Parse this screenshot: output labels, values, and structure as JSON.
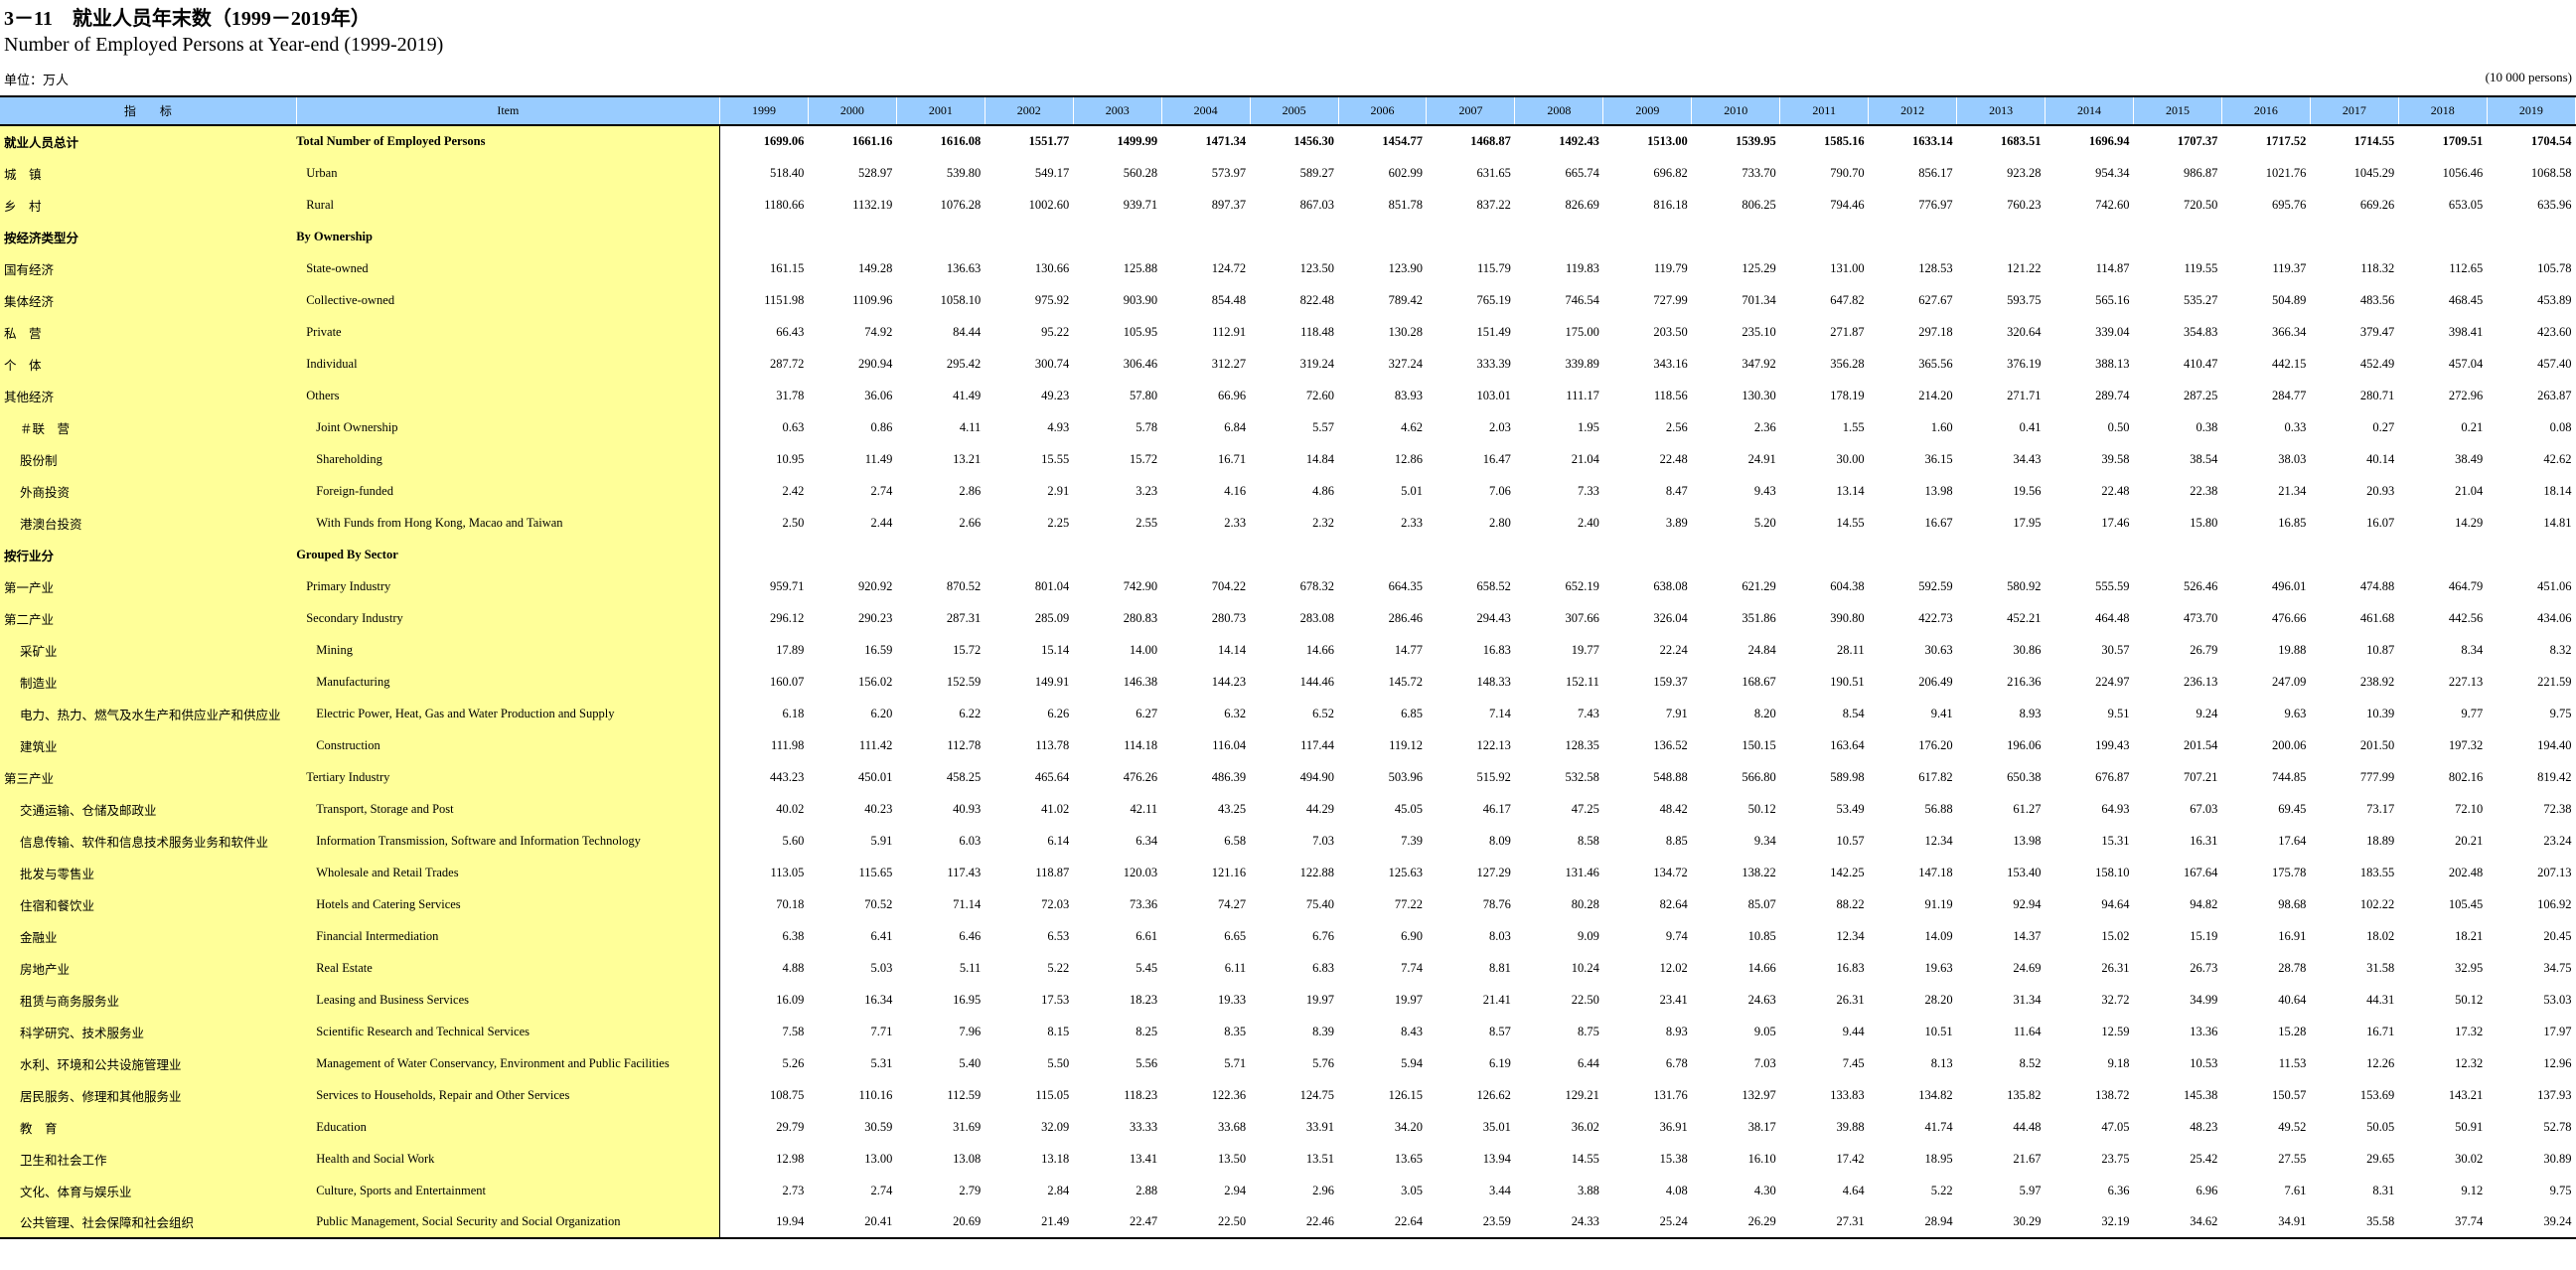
{
  "title_cn": "3－11　就业人员年末数（1999－2019年）",
  "title_en": "Number of Employed Persons at Year-end (1999-2019)",
  "unit_cn": "单位：万人",
  "unit_en": "(10 000 persons)",
  "header": {
    "indicator": "指　　标",
    "item": "Item",
    "years": [
      "1999",
      "2000",
      "2001",
      "2002",
      "2003",
      "2004",
      "2005",
      "2006",
      "2007",
      "2008",
      "2009",
      "2010",
      "2011",
      "2012",
      "2013",
      "2014",
      "2015",
      "2016",
      "2017",
      "2018",
      "2019"
    ]
  },
  "rows": [
    {
      "cn": "就业人员总计",
      "en": "Total Number of Employed Persons",
      "bold": true,
      "ind": 0,
      "v": [
        "1699.06",
        "1661.16",
        "1616.08",
        "1551.77",
        "1499.99",
        "1471.34",
        "1456.30",
        "1454.77",
        "1468.87",
        "1492.43",
        "1513.00",
        "1539.95",
        "1585.16",
        "1633.14",
        "1683.51",
        "1696.94",
        "1707.37",
        "1717.52",
        "1714.55",
        "1709.51",
        "1704.54"
      ]
    },
    {
      "cn": "城　镇",
      "en": "Urban",
      "bold": false,
      "ind": 1,
      "v": [
        "518.40",
        "528.97",
        "539.80",
        "549.17",
        "560.28",
        "573.97",
        "589.27",
        "602.99",
        "631.65",
        "665.74",
        "696.82",
        "733.70",
        "790.70",
        "856.17",
        "923.28",
        "954.34",
        "986.87",
        "1021.76",
        "1045.29",
        "1056.46",
        "1068.58"
      ]
    },
    {
      "cn": "乡　村",
      "en": "Rural",
      "bold": false,
      "ind": 1,
      "v": [
        "1180.66",
        "1132.19",
        "1076.28",
        "1002.60",
        "939.71",
        "897.37",
        "867.03",
        "851.78",
        "837.22",
        "826.69",
        "816.18",
        "806.25",
        "794.46",
        "776.97",
        "760.23",
        "742.60",
        "720.50",
        "695.76",
        "669.26",
        "653.05",
        "635.96"
      ]
    },
    {
      "cn": "按经济类型分",
      "en": "By Ownership",
      "bold": true,
      "ind": 0,
      "v": [
        "",
        "",
        "",
        "",
        "",
        "",
        "",
        "",
        "",
        "",
        "",
        "",
        "",
        "",
        "",
        "",
        "",
        "",
        "",
        "",
        ""
      ]
    },
    {
      "cn": "国有经济",
      "en": "State-owned",
      "bold": false,
      "ind": 1,
      "v": [
        "161.15",
        "149.28",
        "136.63",
        "130.66",
        "125.88",
        "124.72",
        "123.50",
        "123.90",
        "115.79",
        "119.83",
        "119.79",
        "125.29",
        "131.00",
        "128.53",
        "121.22",
        "114.87",
        "119.55",
        "119.37",
        "118.32",
        "112.65",
        "105.78"
      ]
    },
    {
      "cn": "集体经济",
      "en": "Collective-owned",
      "bold": false,
      "ind": 1,
      "v": [
        "1151.98",
        "1109.96",
        "1058.10",
        "975.92",
        "903.90",
        "854.48",
        "822.48",
        "789.42",
        "765.19",
        "746.54",
        "727.99",
        "701.34",
        "647.82",
        "627.67",
        "593.75",
        "565.16",
        "535.27",
        "504.89",
        "483.56",
        "468.45",
        "453.89"
      ]
    },
    {
      "cn": "私　营",
      "en": "Private",
      "bold": false,
      "ind": 1,
      "v": [
        "66.43",
        "74.92",
        "84.44",
        "95.22",
        "105.95",
        "112.91",
        "118.48",
        "130.28",
        "151.49",
        "175.00",
        "203.50",
        "235.10",
        "271.87",
        "297.18",
        "320.64",
        "339.04",
        "354.83",
        "366.34",
        "379.47",
        "398.41",
        "423.60"
      ]
    },
    {
      "cn": "个　体",
      "en": "Individual",
      "bold": false,
      "ind": 1,
      "v": [
        "287.72",
        "290.94",
        "295.42",
        "300.74",
        "306.46",
        "312.27",
        "319.24",
        "327.24",
        "333.39",
        "339.89",
        "343.16",
        "347.92",
        "356.28",
        "365.56",
        "376.19",
        "388.13",
        "410.47",
        "442.15",
        "452.49",
        "457.04",
        "457.40"
      ]
    },
    {
      "cn": "其他经济",
      "en": "Others",
      "bold": false,
      "ind": 1,
      "v": [
        "31.78",
        "36.06",
        "41.49",
        "49.23",
        "57.80",
        "66.96",
        "72.60",
        "83.93",
        "103.01",
        "111.17",
        "118.56",
        "130.30",
        "178.19",
        "214.20",
        "271.71",
        "289.74",
        "287.25",
        "284.77",
        "280.71",
        "272.96",
        "263.87"
      ]
    },
    {
      "cn": "＃联　营",
      "en": "Joint Ownership",
      "bold": false,
      "ind": 2,
      "v": [
        "0.63",
        "0.86",
        "4.11",
        "4.93",
        "5.78",
        "6.84",
        "5.57",
        "4.62",
        "2.03",
        "1.95",
        "2.56",
        "2.36",
        "1.55",
        "1.60",
        "0.41",
        "0.50",
        "0.38",
        "0.33",
        "0.27",
        "0.21",
        "0.08"
      ]
    },
    {
      "cn": "股份制",
      "en": "Shareholding",
      "bold": false,
      "ind": 2,
      "v": [
        "10.95",
        "11.49",
        "13.21",
        "15.55",
        "15.72",
        "16.71",
        "14.84",
        "12.86",
        "16.47",
        "21.04",
        "22.48",
        "24.91",
        "30.00",
        "36.15",
        "34.43",
        "39.58",
        "38.54",
        "38.03",
        "40.14",
        "38.49",
        "42.62"
      ]
    },
    {
      "cn": "外商投资",
      "en": "Foreign-funded",
      "bold": false,
      "ind": 2,
      "v": [
        "2.42",
        "2.74",
        "2.86",
        "2.91",
        "3.23",
        "4.16",
        "4.86",
        "5.01",
        "7.06",
        "7.33",
        "8.47",
        "9.43",
        "13.14",
        "13.98",
        "19.56",
        "22.48",
        "22.38",
        "21.34",
        "20.93",
        "21.04",
        "18.14"
      ]
    },
    {
      "cn": "港澳台投资",
      "en": "With Funds from Hong Kong, Macao and Taiwan",
      "bold": false,
      "ind": 2,
      "v": [
        "2.50",
        "2.44",
        "2.66",
        "2.25",
        "2.55",
        "2.33",
        "2.32",
        "2.33",
        "2.80",
        "2.40",
        "3.89",
        "5.20",
        "14.55",
        "16.67",
        "17.95",
        "17.46",
        "15.80",
        "16.85",
        "16.07",
        "14.29",
        "14.81"
      ]
    },
    {
      "cn": "按行业分",
      "en": "Grouped By Sector",
      "bold": true,
      "ind": 0,
      "v": [
        "",
        "",
        "",
        "",
        "",
        "",
        "",
        "",
        "",
        "",
        "",
        "",
        "",
        "",
        "",
        "",
        "",
        "",
        "",
        "",
        ""
      ]
    },
    {
      "cn": "第一产业",
      "en": "Primary Industry",
      "bold": false,
      "ind": 1,
      "v": [
        "959.71",
        "920.92",
        "870.52",
        "801.04",
        "742.90",
        "704.22",
        "678.32",
        "664.35",
        "658.52",
        "652.19",
        "638.08",
        "621.29",
        "604.38",
        "592.59",
        "580.92",
        "555.59",
        "526.46",
        "496.01",
        "474.88",
        "464.79",
        "451.06"
      ]
    },
    {
      "cn": "第二产业",
      "en": "Secondary Industry",
      "bold": false,
      "ind": 1,
      "v": [
        "296.12",
        "290.23",
        "287.31",
        "285.09",
        "280.83",
        "280.73",
        "283.08",
        "286.46",
        "294.43",
        "307.66",
        "326.04",
        "351.86",
        "390.80",
        "422.73",
        "452.21",
        "464.48",
        "473.70",
        "476.66",
        "461.68",
        "442.56",
        "434.06"
      ]
    },
    {
      "cn": "采矿业",
      "en": "Mining",
      "bold": false,
      "ind": 2,
      "v": [
        "17.89",
        "16.59",
        "15.72",
        "15.14",
        "14.00",
        "14.14",
        "14.66",
        "14.77",
        "16.83",
        "19.77",
        "22.24",
        "24.84",
        "28.11",
        "30.63",
        "30.86",
        "30.57",
        "26.79",
        "19.88",
        "10.87",
        "8.34",
        "8.32"
      ]
    },
    {
      "cn": "制造业",
      "en": "Manufacturing",
      "bold": false,
      "ind": 2,
      "v": [
        "160.07",
        "156.02",
        "152.59",
        "149.91",
        "146.38",
        "144.23",
        "144.46",
        "145.72",
        "148.33",
        "152.11",
        "159.37",
        "168.67",
        "190.51",
        "206.49",
        "216.36",
        "224.97",
        "236.13",
        "247.09",
        "238.92",
        "227.13",
        "221.59"
      ]
    },
    {
      "cn": "电力、热力、燃气及水生产和供应业产和供应业",
      "en": "Electric Power, Heat, Gas and Water Production and Supply",
      "bold": false,
      "ind": 2,
      "v": [
        "6.18",
        "6.20",
        "6.22",
        "6.26",
        "6.27",
        "6.32",
        "6.52",
        "6.85",
        "7.14",
        "7.43",
        "7.91",
        "8.20",
        "8.54",
        "9.41",
        "8.93",
        "9.51",
        "9.24",
        "9.63",
        "10.39",
        "9.77",
        "9.75"
      ]
    },
    {
      "cn": "建筑业",
      "en": "Construction",
      "bold": false,
      "ind": 2,
      "v": [
        "111.98",
        "111.42",
        "112.78",
        "113.78",
        "114.18",
        "116.04",
        "117.44",
        "119.12",
        "122.13",
        "128.35",
        "136.52",
        "150.15",
        "163.64",
        "176.20",
        "196.06",
        "199.43",
        "201.54",
        "200.06",
        "201.50",
        "197.32",
        "194.40"
      ]
    },
    {
      "cn": "第三产业",
      "en": "Tertiary Industry",
      "bold": false,
      "ind": 1,
      "v": [
        "443.23",
        "450.01",
        "458.25",
        "465.64",
        "476.26",
        "486.39",
        "494.90",
        "503.96",
        "515.92",
        "532.58",
        "548.88",
        "566.80",
        "589.98",
        "617.82",
        "650.38",
        "676.87",
        "707.21",
        "744.85",
        "777.99",
        "802.16",
        "819.42"
      ]
    },
    {
      "cn": "交通运输、仓储及邮政业",
      "en": "Transport, Storage and Post",
      "bold": false,
      "ind": 2,
      "v": [
        "40.02",
        "40.23",
        "40.93",
        "41.02",
        "42.11",
        "43.25",
        "44.29",
        "45.05",
        "46.17",
        "47.25",
        "48.42",
        "50.12",
        "53.49",
        "56.88",
        "61.27",
        "64.93",
        "67.03",
        "69.45",
        "73.17",
        "72.10",
        "72.38"
      ]
    },
    {
      "cn": "信息传输、软件和信息技术服务业务和软件业",
      "en": "Information Transmission, Software and Information Technology",
      "bold": false,
      "ind": 2,
      "v": [
        "5.60",
        "5.91",
        "6.03",
        "6.14",
        "6.34",
        "6.58",
        "7.03",
        "7.39",
        "8.09",
        "8.58",
        "8.85",
        "9.34",
        "10.57",
        "12.34",
        "13.98",
        "15.31",
        "16.31",
        "17.64",
        "18.89",
        "20.21",
        "23.24"
      ]
    },
    {
      "cn": "批发与零售业",
      "en": "Wholesale and Retail Trades",
      "bold": false,
      "ind": 2,
      "v": [
        "113.05",
        "115.65",
        "117.43",
        "118.87",
        "120.03",
        "121.16",
        "122.88",
        "125.63",
        "127.29",
        "131.46",
        "134.72",
        "138.22",
        "142.25",
        "147.18",
        "153.40",
        "158.10",
        "167.64",
        "175.78",
        "183.55",
        "202.48",
        "207.13"
      ]
    },
    {
      "cn": "住宿和餐饮业",
      "en": "Hotels and Catering Services",
      "bold": false,
      "ind": 2,
      "v": [
        "70.18",
        "70.52",
        "71.14",
        "72.03",
        "73.36",
        "74.27",
        "75.40",
        "77.22",
        "78.76",
        "80.28",
        "82.64",
        "85.07",
        "88.22",
        "91.19",
        "92.94",
        "94.64",
        "94.82",
        "98.68",
        "102.22",
        "105.45",
        "106.92"
      ]
    },
    {
      "cn": "金融业",
      "en": "Financial Intermediation",
      "bold": false,
      "ind": 2,
      "v": [
        "6.38",
        "6.41",
        "6.46",
        "6.53",
        "6.61",
        "6.65",
        "6.76",
        "6.90",
        "8.03",
        "9.09",
        "9.74",
        "10.85",
        "12.34",
        "14.09",
        "14.37",
        "15.02",
        "15.19",
        "16.91",
        "18.02",
        "18.21",
        "20.45"
      ]
    },
    {
      "cn": "房地产业",
      "en": "Real Estate",
      "bold": false,
      "ind": 2,
      "v": [
        "4.88",
        "5.03",
        "5.11",
        "5.22",
        "5.45",
        "6.11",
        "6.83",
        "7.74",
        "8.81",
        "10.24",
        "12.02",
        "14.66",
        "16.83",
        "19.63",
        "24.69",
        "26.31",
        "26.73",
        "28.78",
        "31.58",
        "32.95",
        "34.75"
      ]
    },
    {
      "cn": "租赁与商务服务业",
      "en": "Leasing and Business Services",
      "bold": false,
      "ind": 2,
      "v": [
        "16.09",
        "16.34",
        "16.95",
        "17.53",
        "18.23",
        "19.33",
        "19.97",
        "19.97",
        "21.41",
        "22.50",
        "23.41",
        "24.63",
        "26.31",
        "28.20",
        "31.34",
        "32.72",
        "34.99",
        "40.64",
        "44.31",
        "50.12",
        "53.03"
      ]
    },
    {
      "cn": "科学研究、技术服务业",
      "en": "Scientific Research and Technical Services",
      "bold": false,
      "ind": 2,
      "v": [
        "7.58",
        "7.71",
        "7.96",
        "8.15",
        "8.25",
        "8.35",
        "8.39",
        "8.43",
        "8.57",
        "8.75",
        "8.93",
        "9.05",
        "9.44",
        "10.51",
        "11.64",
        "12.59",
        "13.36",
        "15.28",
        "16.71",
        "17.32",
        "17.97"
      ]
    },
    {
      "cn": "水利、环境和公共设施管理业",
      "en": "Management of Water Conservancy, Environment and Public Facilities",
      "bold": false,
      "ind": 2,
      "v": [
        "5.26",
        "5.31",
        "5.40",
        "5.50",
        "5.56",
        "5.71",
        "5.76",
        "5.94",
        "6.19",
        "6.44",
        "6.78",
        "7.03",
        "7.45",
        "8.13",
        "8.52",
        "9.18",
        "10.53",
        "11.53",
        "12.26",
        "12.32",
        "12.96"
      ]
    },
    {
      "cn": "居民服务、修理和其他服务业",
      "en": "Services to Households, Repair and Other Services",
      "bold": false,
      "ind": 2,
      "v": [
        "108.75",
        "110.16",
        "112.59",
        "115.05",
        "118.23",
        "122.36",
        "124.75",
        "126.15",
        "126.62",
        "129.21",
        "131.76",
        "132.97",
        "133.83",
        "134.82",
        "135.82",
        "138.72",
        "145.38",
        "150.57",
        "153.69",
        "143.21",
        "137.93"
      ]
    },
    {
      "cn": "教　育",
      "en": "Education",
      "bold": false,
      "ind": 2,
      "v": [
        "29.79",
        "30.59",
        "31.69",
        "32.09",
        "33.33",
        "33.68",
        "33.91",
        "34.20",
        "35.01",
        "36.02",
        "36.91",
        "38.17",
        "39.88",
        "41.74",
        "44.48",
        "47.05",
        "48.23",
        "49.52",
        "50.05",
        "50.91",
        "52.78"
      ]
    },
    {
      "cn": "卫生和社会工作",
      "en": "Health and Social Work",
      "bold": false,
      "ind": 2,
      "v": [
        "12.98",
        "13.00",
        "13.08",
        "13.18",
        "13.41",
        "13.50",
        "13.51",
        "13.65",
        "13.94",
        "14.55",
        "15.38",
        "16.10",
        "17.42",
        "18.95",
        "21.67",
        "23.75",
        "25.42",
        "27.55",
        "29.65",
        "30.02",
        "30.89"
      ]
    },
    {
      "cn": "文化、体育与娱乐业",
      "en": "Culture, Sports and Entertainment",
      "bold": false,
      "ind": 2,
      "v": [
        "2.73",
        "2.74",
        "2.79",
        "2.84",
        "2.88",
        "2.94",
        "2.96",
        "3.05",
        "3.44",
        "3.88",
        "4.08",
        "4.30",
        "4.64",
        "5.22",
        "5.97",
        "6.36",
        "6.96",
        "7.61",
        "8.31",
        "9.12",
        "9.75"
      ]
    },
    {
      "cn": "公共管理、社会保障和社会组织",
      "en": "Public Management, Social Security and Social Organization",
      "bold": false,
      "ind": 2,
      "v": [
        "19.94",
        "20.41",
        "20.69",
        "21.49",
        "22.47",
        "22.50",
        "22.46",
        "22.64",
        "23.59",
        "24.33",
        "25.24",
        "26.29",
        "27.31",
        "28.94",
        "30.29",
        "32.19",
        "34.62",
        "34.91",
        "35.58",
        "37.74",
        "39.24"
      ]
    }
  ]
}
